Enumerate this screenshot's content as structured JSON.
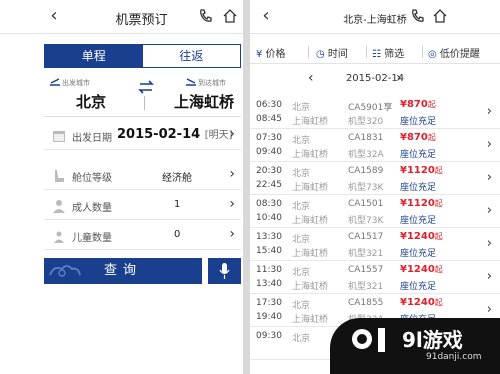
{
  "left": {
    "title": "机票预订",
    "tabs": [
      "单程",
      "往返"
    ],
    "depart_label": "出发城市",
    "arrive_label": "到达城市",
    "depart_city": "北京",
    "arrive_city": "上海虹桥",
    "date_label": "出发日期",
    "date_value": "2015-02-14",
    "date_suffix": "[明天]",
    "cabin_label": "舱位等级",
    "cabin_value": "经济舱",
    "adult_label": "成人数量",
    "adult_value": "1",
    "child_label": "儿童数量",
    "child_value": "0",
    "search_label": "查询"
  },
  "right": {
    "title": "北京-上海虹桥",
    "filters": {
      "price": "价格",
      "time": "时间",
      "screen": "筛选",
      "alert": "低价提醒"
    },
    "date": "2015-02-14",
    "flights": [
      {
        "dep": "06:30",
        "arr": "08:45",
        "from": "北京",
        "to": "上海虹桥",
        "no": "CA5901享",
        "model": "机型320",
        "price": "¥870",
        "unit": "起",
        "seat": "座位充足"
      },
      {
        "dep": "07:30",
        "arr": "09:40",
        "from": "北京",
        "to": "上海虹桥",
        "no": "CA1831",
        "model": "机型32A",
        "price": "¥870",
        "unit": "起",
        "seat": "座位充足"
      },
      {
        "dep": "20:30",
        "arr": "22:45",
        "from": "北京",
        "to": "上海虹桥",
        "no": "CA1589",
        "model": "机型73K",
        "price": "¥1120",
        "unit": "起",
        "seat": "座位充足"
      },
      {
        "dep": "08:30",
        "arr": "10:40",
        "from": "北京",
        "to": "上海虹桥",
        "no": "CA1501",
        "model": "机型73K",
        "price": "¥1120",
        "unit": "起",
        "seat": "座位充足"
      },
      {
        "dep": "13:30",
        "arr": "15:40",
        "from": "北京",
        "to": "上海虹桥",
        "no": "CA1517",
        "model": "机型321",
        "price": "¥1240",
        "unit": "起",
        "seat": "座位充足"
      },
      {
        "dep": "11:30",
        "arr": "13:40",
        "from": "北京",
        "to": "上海虹桥",
        "no": "CA1557",
        "model": "机型321",
        "price": "¥1240",
        "unit": "起",
        "seat": "座位充足"
      },
      {
        "dep": "17:30",
        "arr": "19:40",
        "from": "北京",
        "to": "上海虹桥",
        "no": "CA1855",
        "model": "机型32A",
        "price": "¥1240",
        "unit": "起",
        "seat": "座位充足"
      },
      {
        "dep": "09:30",
        "arr": "",
        "from": "北京",
        "to": "",
        "no": "CA",
        "model": "",
        "price": "",
        "unit": "",
        "seat": ""
      }
    ]
  },
  "watermark": {
    "brand": "9l游戏",
    "url": "91danji.com"
  },
  "colors": {
    "primary": "#1b3f8f",
    "price": "#e0202c"
  }
}
